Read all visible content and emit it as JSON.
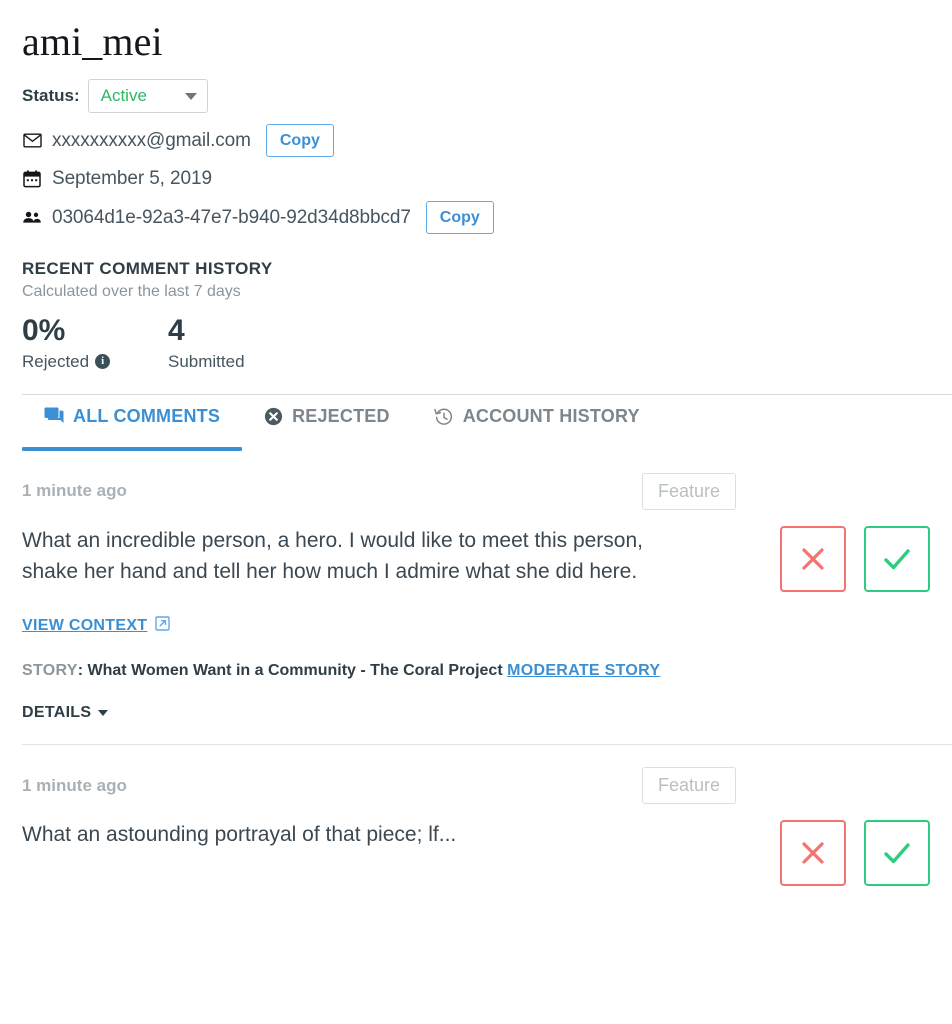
{
  "user": {
    "username": "ami_mei",
    "status_label": "Status:",
    "status_value": "Active",
    "email": "xxxxxxxxxx@gmail.com",
    "email_copy_label": "Copy",
    "member_since": "September 5, 2019",
    "user_id": "03064d1e-92a3-47e7-b940-92d34d8bbcd7",
    "id_copy_label": "Copy"
  },
  "recent_history": {
    "title": "RECENT COMMENT HISTORY",
    "subtitle": "Calculated over the last 7 days",
    "stats": [
      {
        "value": "0%",
        "label": "Rejected",
        "has_info": true
      },
      {
        "value": "4",
        "label": "Submitted",
        "has_info": false
      }
    ]
  },
  "tabs": [
    {
      "label": "ALL COMMENTS",
      "icon": "forum-icon",
      "active": true
    },
    {
      "label": "REJECTED",
      "icon": "cancel-circle-icon",
      "active": false
    },
    {
      "label": "ACCOUNT HISTORY",
      "icon": "history-icon",
      "active": false
    }
  ],
  "comments": [
    {
      "time": "1 minute ago",
      "feature_label": "Feature",
      "text": "What an incredible person, a hero. I would like to meet this person, shake her hand and tell her how much I admire what she did here.",
      "view_context_label": "VIEW CONTEXT",
      "story_key": "STORY",
      "story_separator": ": ",
      "story_title": "What Women Want in a Community - The Coral Project",
      "moderate_story_label": "MODERATE STORY",
      "details_label": "DETAILS"
    },
    {
      "time": "1 minute ago",
      "feature_label": "Feature",
      "text": "What an astounding portrayal of that piece; lf..."
    }
  ],
  "colors": {
    "accent_blue": "#3b8fd4",
    "status_green": "#2ab766",
    "reject_red": "#f4736f",
    "approve_green": "#2fcb7f",
    "text_dark": "#2f3e46",
    "text_muted": "#8c969c"
  }
}
